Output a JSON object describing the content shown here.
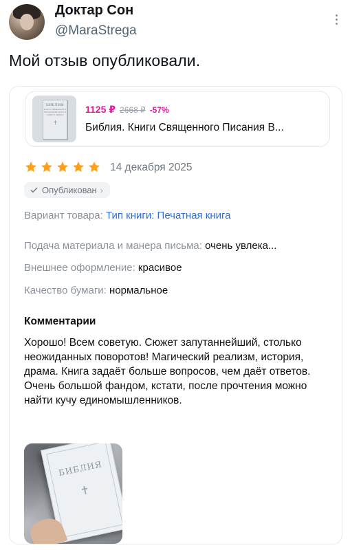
{
  "tweet": {
    "author_name": "Доктар Сон",
    "author_handle": "@MaraStrega",
    "text": "Мой отзыв опубликовали."
  },
  "review": {
    "product": {
      "thumb_title": "БИБЛИЯ",
      "thumb_subtitle": "КНИГИ СВЯЩЕННОГО ПИСАНИЯ ВЕТХОГО И НОВОГО ЗАВЕТА",
      "thumb_cross": "✝",
      "price_now": "1125 ₽",
      "price_old": "2668 ₽",
      "discount": "-57%",
      "name": "Библия. Книги Священного Писания В..."
    },
    "rating": 5,
    "star_color": "#ff9f1a",
    "date": "14 декабря 2025",
    "status_label": "Опубликован",
    "status_chevron": "›",
    "variant": {
      "label": "Вариант товара:",
      "value": "Тип книги: Печатная книга"
    },
    "attributes": [
      {
        "label": "Подача материала и манера письма:",
        "value": "очень увлека..."
      },
      {
        "label": "Внешнее оформление:",
        "value": "красивое"
      },
      {
        "label": "Качество бумаги:",
        "value": "нормальное"
      }
    ],
    "comments_title": "Комментарии",
    "comment": "Хорошо! Всем советую. Сюжет запутаннейший, столько неожиданных поворотов! Магический реализм, история, драма. Книга задаёт больше вопросов, чем даёт ответов. Очень большой фандом, кстати, после прочтения можно найти кучу единомышленников.",
    "photo": {
      "book_title": "БИБЛИЯ",
      "book_cross": "✝"
    }
  },
  "colors": {
    "accent_pink": "#e0199b",
    "link_blue": "#2a6fd6"
  }
}
